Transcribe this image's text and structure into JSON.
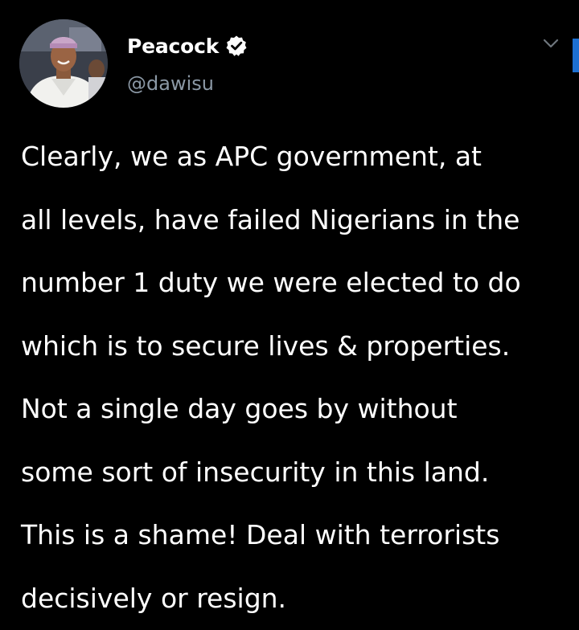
{
  "author": {
    "display_name": "Peacock",
    "handle": "@dawisu",
    "verified": true
  },
  "icons": {
    "avatar": "profile-photo",
    "verified": "verified-badge-icon",
    "menu": "chevron-down-icon"
  },
  "tweet": {
    "lines": [
      "Clearly, we as APC government, at",
      "all levels, have failed Nigerians in the",
      "number 1 duty we were elected to do",
      "which is to secure lives & properties.",
      "Not a single day goes by without",
      "some sort of insecurity in this land.",
      "This is a shame! Deal with terrorists",
      "decisively or resign."
    ]
  },
  "colors": {
    "background": "#000000",
    "text": "#ffffff",
    "handle": "#8b98a5",
    "accent": "#1d6fd1"
  }
}
